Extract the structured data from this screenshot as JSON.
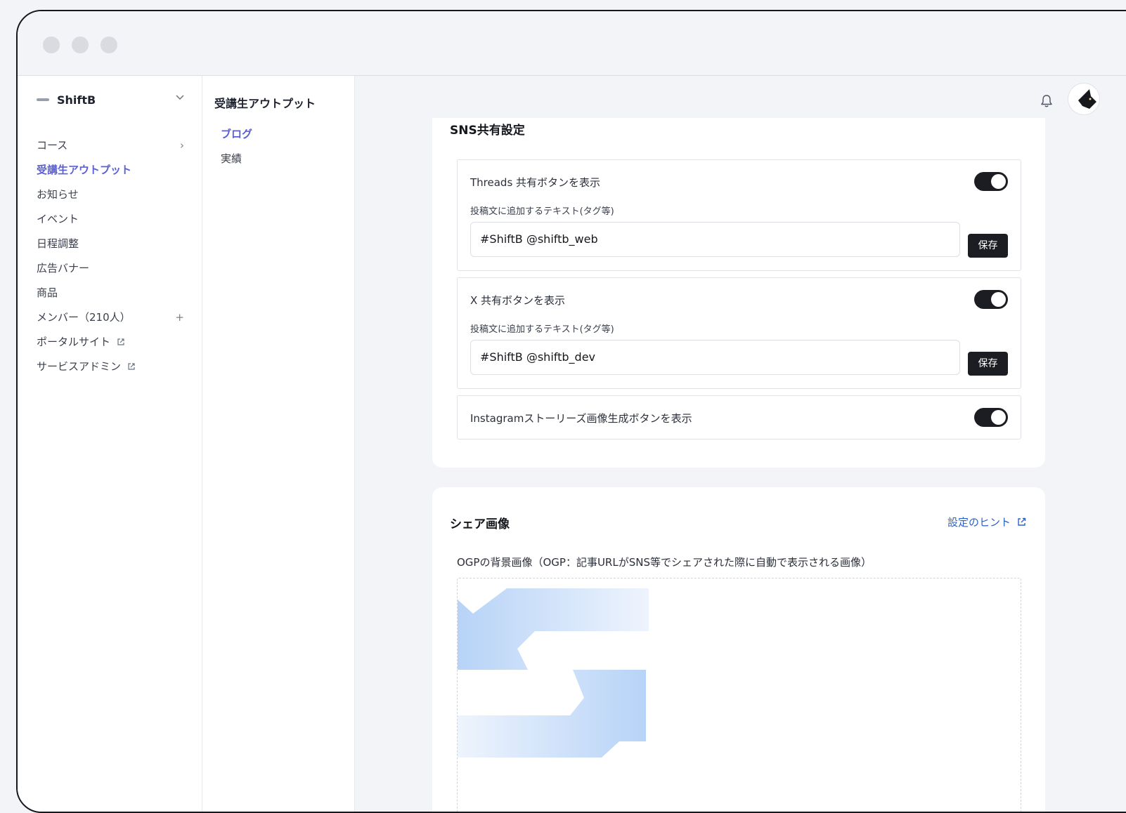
{
  "sidebar": {
    "brand": "ShiftB",
    "items": [
      {
        "label": "コース",
        "right": "›"
      },
      {
        "label": "受講生アウトプット",
        "active": true
      },
      {
        "label": "お知らせ"
      },
      {
        "label": "イベント"
      },
      {
        "label": "日程調整"
      },
      {
        "label": "広告バナー"
      },
      {
        "label": "商品"
      },
      {
        "label": "メンバー（210人）",
        "right": "+"
      },
      {
        "label": "ポータルサイト",
        "external": true
      },
      {
        "label": "サービスアドミン",
        "external": true
      }
    ]
  },
  "subnav": {
    "title": "受講生アウトプット",
    "items": [
      {
        "label": "ブログ",
        "active": true
      },
      {
        "label": "実績"
      }
    ]
  },
  "sns": {
    "title": "SNS共有設定",
    "threads": {
      "label": "Threads 共有ボタンを表示",
      "toggle_on": true,
      "sublabel": "投稿文に追加するテキスト(タグ等)",
      "value": "#ShiftB @shiftb_web",
      "save": "保存"
    },
    "x": {
      "label": "X 共有ボタンを表示",
      "toggle_on": true,
      "sublabel": "投稿文に追加するテキスト(タグ等)",
      "value": "#ShiftB @shiftb_dev",
      "save": "保存"
    },
    "instagram": {
      "label": "Instagramストーリーズ画像生成ボタンを表示",
      "toggle_on": true
    }
  },
  "share_image": {
    "title": "シェア画像",
    "hint_link": "設定のヒント",
    "ogp_label": "OGPの背景画像（OGP：記事URLがSNS等でシェアされた際に自動で表示される画像）"
  },
  "colors": {
    "accent": "#5b5fd6",
    "link": "#2a62c9",
    "toggle_on": "#1b1d22",
    "button": "#1b1d22"
  }
}
